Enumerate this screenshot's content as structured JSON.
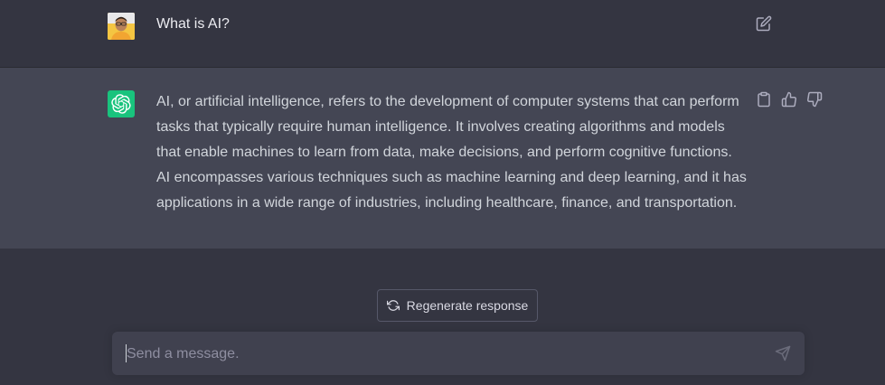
{
  "user_message": {
    "text": "What is AI?",
    "avatar": "user-photo",
    "edit_icon": "edit-icon"
  },
  "assistant_message": {
    "text": "AI, or artificial intelligence, refers to the development of computer systems that can perform tasks that typically require human intelligence. It involves creating algorithms and models that enable machines to learn from data, make decisions, and perform cognitive functions. AI encompasses various techniques such as machine learning and deep learning, and it has applications in a wide range of industries, including healthcare, finance, and transportation.",
    "avatar": "openai-logo",
    "actions": [
      "copy-icon",
      "thumbs-up-icon",
      "thumbs-down-icon"
    ]
  },
  "regenerate": {
    "label": "Regenerate response",
    "icon": "refresh-icon"
  },
  "composer": {
    "placeholder": "Send a message.",
    "value": "",
    "send_icon": "send-icon"
  },
  "colors": {
    "background": "#343541",
    "assistant_background": "#444654",
    "accent": "#19c37d",
    "input_background": "#40414f"
  }
}
